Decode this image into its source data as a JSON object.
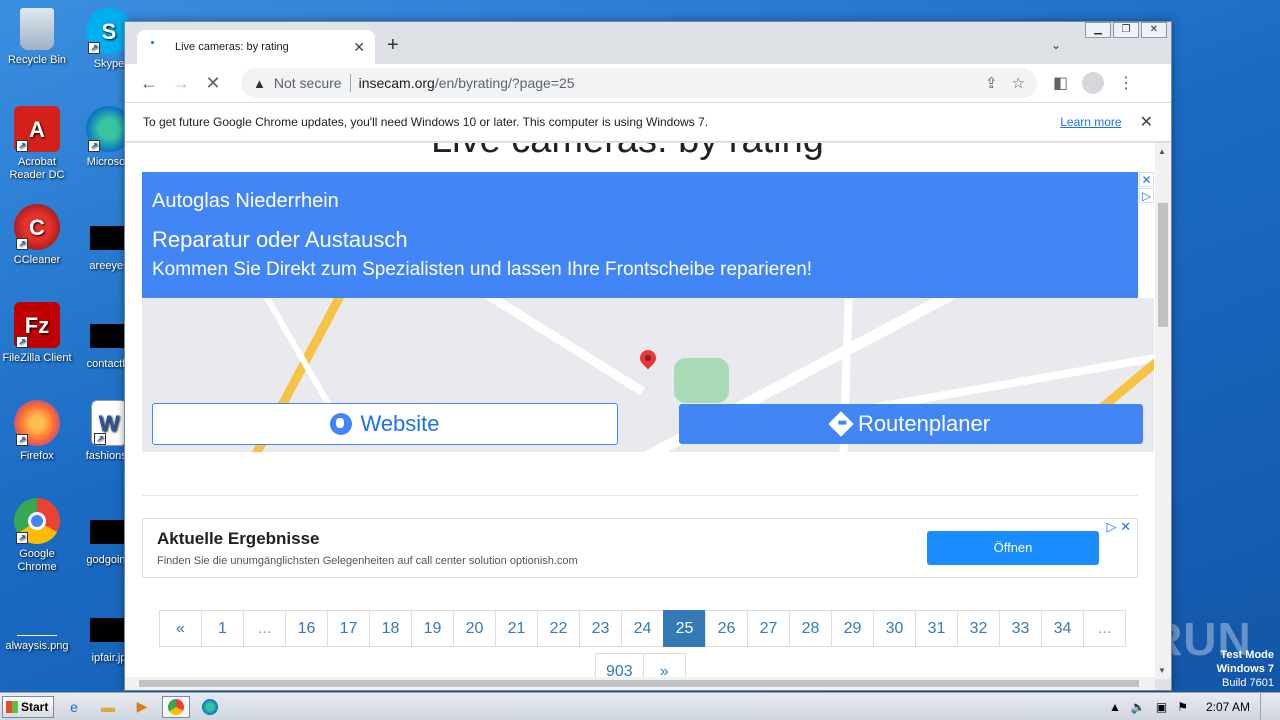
{
  "desktop": {
    "icons": [
      {
        "label": "Recycle Bin",
        "icon": "recycle-bin-icon"
      },
      {
        "label": "Skype",
        "icon": "skype-icon"
      },
      {
        "label": "Acrobat Reader DC",
        "icon": "acrobat-icon"
      },
      {
        "label": "Microsoft",
        "icon": "edge-icon"
      },
      {
        "label": "CCleaner",
        "icon": "ccleaner-icon"
      },
      {
        "label": "areeyes",
        "icon": "file-icon"
      },
      {
        "label": "FileZilla Client",
        "icon": "filezilla-icon"
      },
      {
        "label": "contactfri",
        "icon": "file-icon"
      },
      {
        "label": "Firefox",
        "icon": "firefox-icon"
      },
      {
        "label": "fashionsy",
        "icon": "word-doc-icon"
      },
      {
        "label": "Google Chrome",
        "icon": "chrome-icon"
      },
      {
        "label": "godgoing",
        "icon": "file-icon"
      },
      {
        "label": "alwaysis.png",
        "icon": "image-file-icon"
      },
      {
        "label": "ipfair.jp",
        "icon": "file-icon"
      }
    ],
    "watermark": {
      "line1": "Test Mode",
      "line2": "Windows 7",
      "line3": "Build 7601"
    },
    "anyrun": "ANY RUN"
  },
  "browser": {
    "tab_title": "Live cameras: by rating",
    "new_tab": "+",
    "address": {
      "security": "Not secure",
      "host": "insecam.org",
      "path": "/en/byrating/?page=25"
    },
    "infobar": {
      "message": "To get future Google Chrome updates, you'll need Windows 10 or later. This computer is using Windows 7.",
      "link": "Learn more"
    }
  },
  "page": {
    "heading": "Live cameras: by rating",
    "ad1": {
      "line1": "Autoglas Niederrhein",
      "line2": "Reparatur oder Austausch",
      "line3": "Kommen Sie Direkt zum Spezialisten und lassen Ihre Frontscheibe reparieren!",
      "website_label": "Website",
      "route_label": "Routenplaner"
    },
    "ad2": {
      "title": "Aktuelle Ergebnisse",
      "desc": "Finden Sie die unumgänglichsten Gelegenheiten auf call center solution optionish.com",
      "button": "Öffnen"
    },
    "pagination": {
      "row1": [
        "«",
        "1",
        "...",
        "16",
        "17",
        "18",
        "19",
        "20",
        "21",
        "22",
        "23",
        "24",
        "25",
        "26",
        "27",
        "28",
        "29",
        "30",
        "31",
        "32",
        "33",
        "34",
        "..."
      ],
      "active": "25",
      "row2": [
        "903",
        "»"
      ]
    }
  },
  "taskbar": {
    "start": "Start",
    "clock": "2:07 AM"
  }
}
